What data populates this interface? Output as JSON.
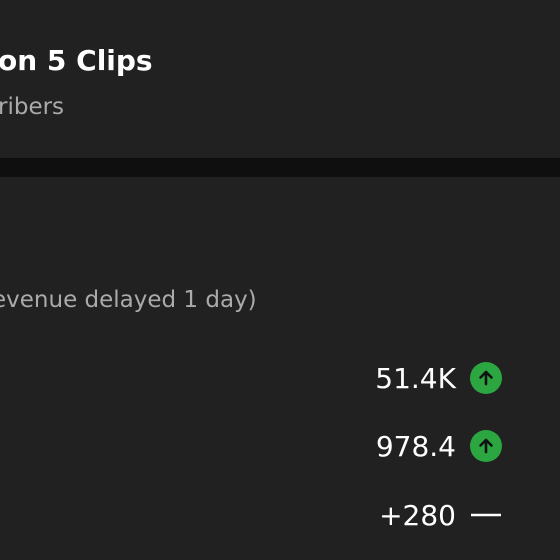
{
  "header": {
    "title": "on 5 Clips",
    "subtitle": "ribers"
  },
  "note": "evenue delayed 1 day)",
  "stats": [
    {
      "value": "51.4K",
      "trend": "up",
      "icon": "arrow-up-circle-icon"
    },
    {
      "value": "978.4",
      "trend": "up",
      "icon": "arrow-up-circle-icon"
    },
    {
      "value": "+280",
      "trend": "flat",
      "icon": "dash-icon"
    }
  ],
  "colors": {
    "background": "#212121",
    "divider": "#0f0f0f",
    "primary_text": "#ffffff",
    "secondary_text": "#aaaaaa",
    "trend_up": "#2ba640"
  }
}
